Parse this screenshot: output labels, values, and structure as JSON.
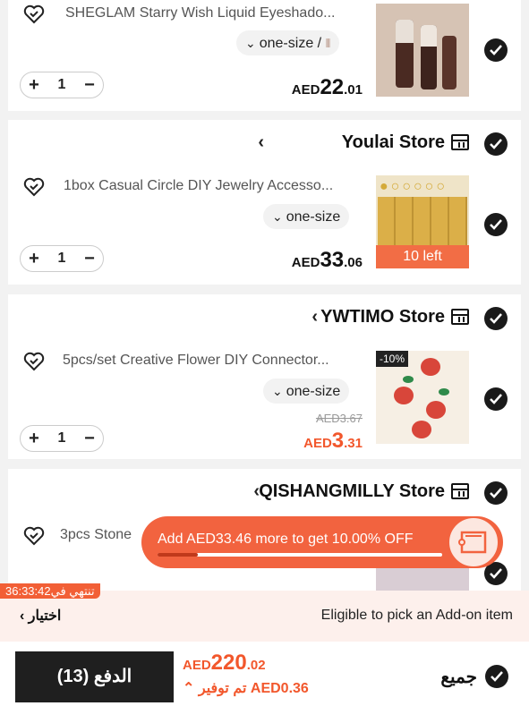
{
  "colors": {
    "accent": "#f2572c",
    "dark": "#1f1f1f"
  },
  "items": [
    {
      "title": "SHEGLAM Starry Wish Liquid Eyeshado...",
      "variant": "one-size /",
      "qty": "1",
      "price": {
        "cur": "AED",
        "int": "22",
        "dec": ".01"
      }
    },
    {
      "store": "Youlai Store",
      "title": "1box Casual Circle DIY Jewelry Accesso...",
      "variant": "one-size",
      "qty": "1",
      "price": {
        "cur": "AED",
        "int": "33",
        "dec": ".06"
      },
      "stock": "10 left"
    },
    {
      "store": "YWTIMO Store",
      "title": "5pcs/set Creative Flower DIY Connector...",
      "variant": "one-size",
      "qty": "1",
      "old_price": "AED3.67",
      "price": {
        "cur": "AED",
        "int": "3",
        "dec": ".31"
      },
      "discount": "-10%"
    },
    {
      "store": "QISHANGMILLY Store",
      "title": "3pcs Stone"
    }
  ],
  "promo": {
    "text": "Add AED33.46 more to get 10.00% OFF",
    "progress": 0.14
  },
  "addon": {
    "timer": "تنتهي في36:33:42",
    "text": "Eligible to pick an Add-on item",
    "choose": "اختيار"
  },
  "bottom": {
    "checkout": "الدفع (13)",
    "total": {
      "cur": "AED",
      "int": "220",
      "dec": ".02"
    },
    "saving": "تم توفير AED0.36",
    "all": "جميع"
  }
}
